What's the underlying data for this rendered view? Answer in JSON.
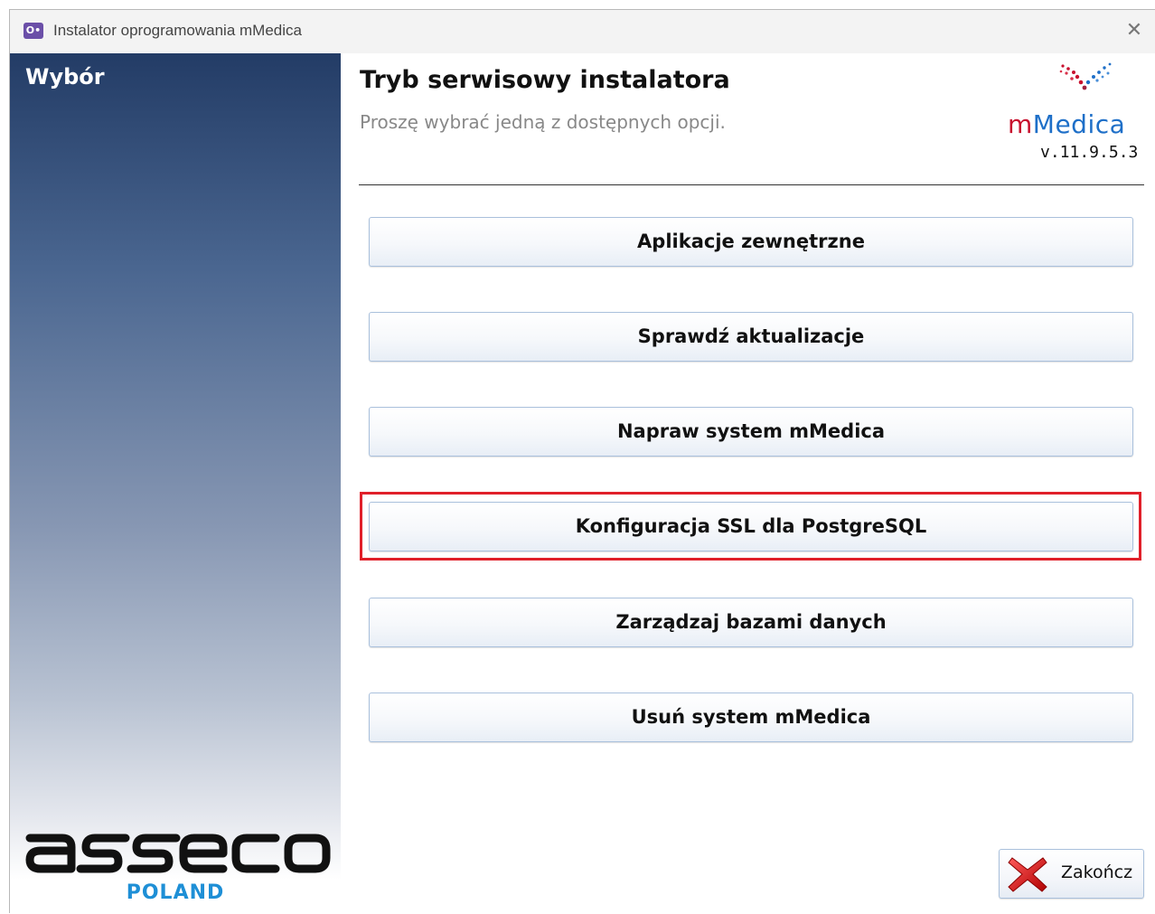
{
  "window": {
    "title": "Instalator oprogramowania mMedica",
    "app_icon_glyph": "O•",
    "close_glyph": "✕"
  },
  "sidebar": {
    "title": "Wybór",
    "brand_logo": "asseco",
    "brand_sub": "POLAND"
  },
  "header": {
    "title": "Tryb serwisowy instalatora",
    "subtitle": "Proszę wybrać jedną z dostępnych opcji.",
    "product_logo_part1": "m",
    "product_logo_part2": "Medica",
    "version": "v.11.9.5.3"
  },
  "options": [
    {
      "label": "Aplikacje zewnętrzne"
    },
    {
      "label": "Sprawdź aktualizacje"
    },
    {
      "label": "Napraw system mMedica"
    },
    {
      "label": "Konfiguracja SSL dla PostgreSQL",
      "highlighted": true
    },
    {
      "label": "Zarządzaj bazami danych"
    },
    {
      "label": "Usuń system mMedica"
    }
  ],
  "footer": {
    "exit_label": "Zakończ"
  },
  "colors": {
    "highlight_border": "#e0202a",
    "brand_blue": "#1e8fd6",
    "mmedica_red": "#c8102e",
    "sidebar_top": "#233c66"
  }
}
